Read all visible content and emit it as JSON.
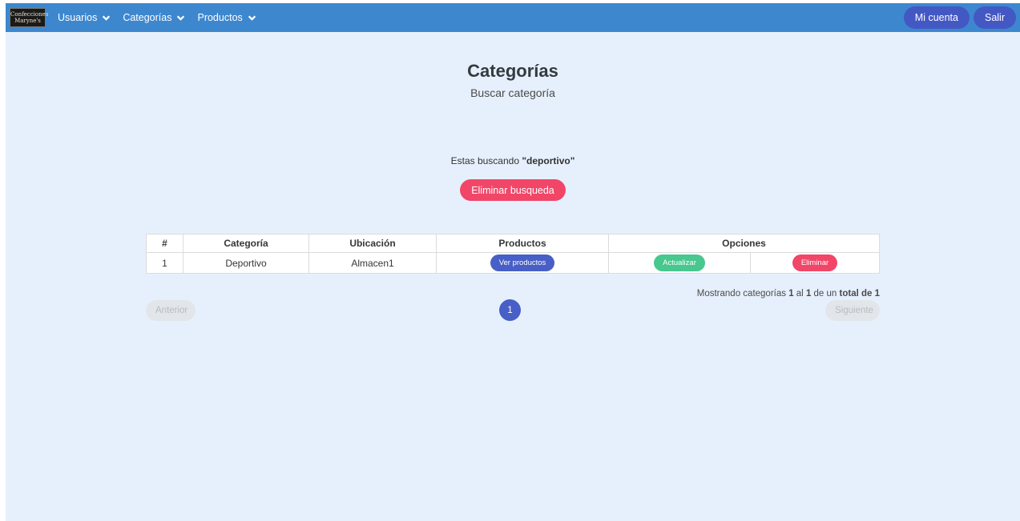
{
  "nav": {
    "logo_text": "Confecciones Maryne's",
    "items": [
      {
        "label": "Usuarios"
      },
      {
        "label": "Categorías"
      },
      {
        "label": "Productos"
      }
    ],
    "account_label": "Mi cuenta",
    "logout_label": "Salir"
  },
  "page": {
    "title": "Categorías",
    "subtitle": "Buscar categoría"
  },
  "search": {
    "prefix": "Estas buscando ",
    "term": "\"deportivo\"",
    "clear_label": "Eliminar busqueda"
  },
  "table": {
    "headers": [
      "#",
      "Categoría",
      "Ubicación",
      "Productos",
      "Opciones"
    ],
    "rows": [
      {
        "num": "1",
        "category": "Deportivo",
        "location": "Almacen1",
        "products_button": "Ver productos",
        "update_button": "Actualizar",
        "delete_button": "Eliminar"
      }
    ]
  },
  "pagination": {
    "summary_prefix": "Mostrando categorías ",
    "from": "1",
    "mid": " al ",
    "to": "1",
    "suffix_plain": " de un ",
    "total": "total de 1",
    "prev_label": "Anterior",
    "next_label": "Siguiente",
    "current_page": "1"
  },
  "colors": {
    "navbar": "#3d87cf",
    "background": "#e6f0fd",
    "primary": "#485fc7",
    "danger": "#f14668",
    "success": "#48c78e"
  }
}
